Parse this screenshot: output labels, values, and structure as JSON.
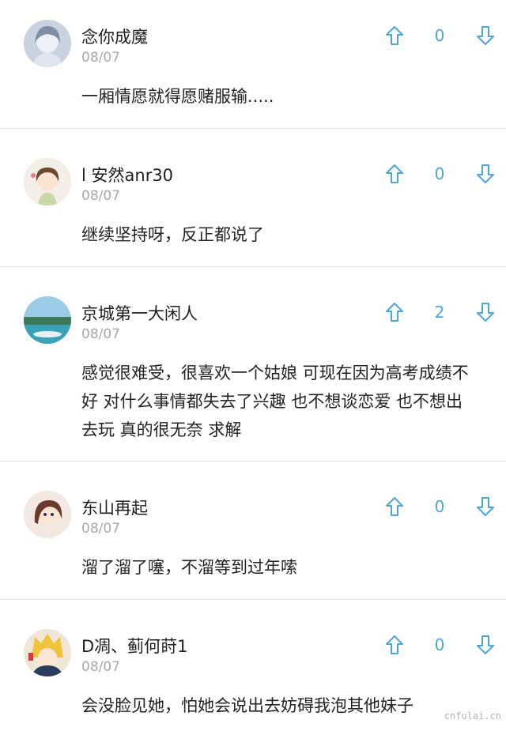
{
  "comments": [
    {
      "username": "念你成魔",
      "date": "08/07",
      "text": "一厢情愿就得愿赌服输.....",
      "votes": "0",
      "avatar": "avatar-girl-sketch"
    },
    {
      "username": "l 安然anr30",
      "date": "08/07",
      "text": "继续坚持呀，反正都说了",
      "votes": "0",
      "avatar": "avatar-cartoon-girl"
    },
    {
      "username": "京城第一大闲人",
      "date": "08/07",
      "text": "感觉很难受，很喜欢一个姑娘 可现在因为高考成绩不好 对什么事情都失去了兴趣 也不想谈恋爱 也不想出去玩 真的很无奈 求解",
      "votes": "2",
      "avatar": "avatar-sea-landscape"
    },
    {
      "username": "东山再起",
      "date": "08/07",
      "text": "溜了溜了噻，不溜等到过年嗦",
      "votes": "0",
      "avatar": "avatar-anime-girl"
    },
    {
      "username": "D凋、蓟何莳1",
      "date": "08/07",
      "text": "会没脸见她，怕她会说出去妨碍我泡其他妹子",
      "votes": "0",
      "avatar": "avatar-anime-boy"
    }
  ],
  "icons": {
    "upvote": "arrow-up-outline-icon",
    "downvote": "arrow-down-outline-icon"
  },
  "colors": {
    "accent": "#4aa6e0",
    "date": "#a9a9a9",
    "divider": "#e3e3e3"
  },
  "watermark": "cnfulai.cn"
}
